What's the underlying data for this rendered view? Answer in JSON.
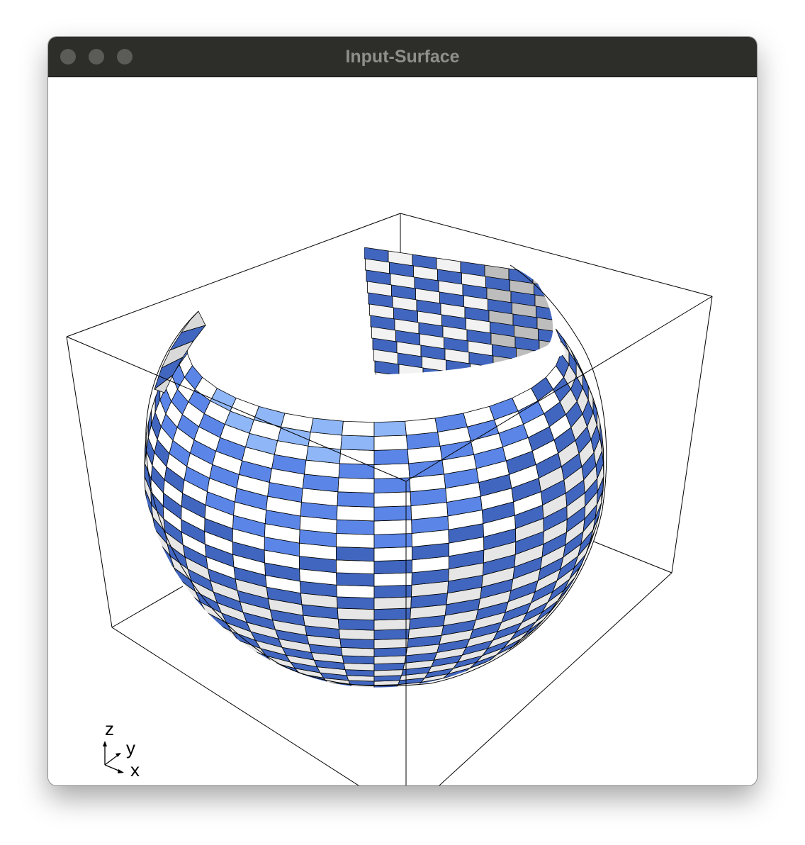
{
  "window": {
    "title": "Input-Surface"
  },
  "axes_triad": {
    "z_label": "z",
    "y_label": "y",
    "x_label": "x"
  },
  "colors": {
    "titlebar": "#2d2d2a",
    "title_text": "#8e8e8b",
    "traffic_light": "#5b5b58",
    "checker_blue": "#5b86e8",
    "checker_blue_dark": "#4166bf",
    "checker_highlight": "#bfe6ff",
    "checker_white": "#ffffff",
    "checker_grey": "#bdbdbd",
    "bounding_box_line": "#000000"
  },
  "surface": {
    "type": "open sphere with checkerboard texture",
    "view": "perspective 3D with bounding box outline"
  }
}
